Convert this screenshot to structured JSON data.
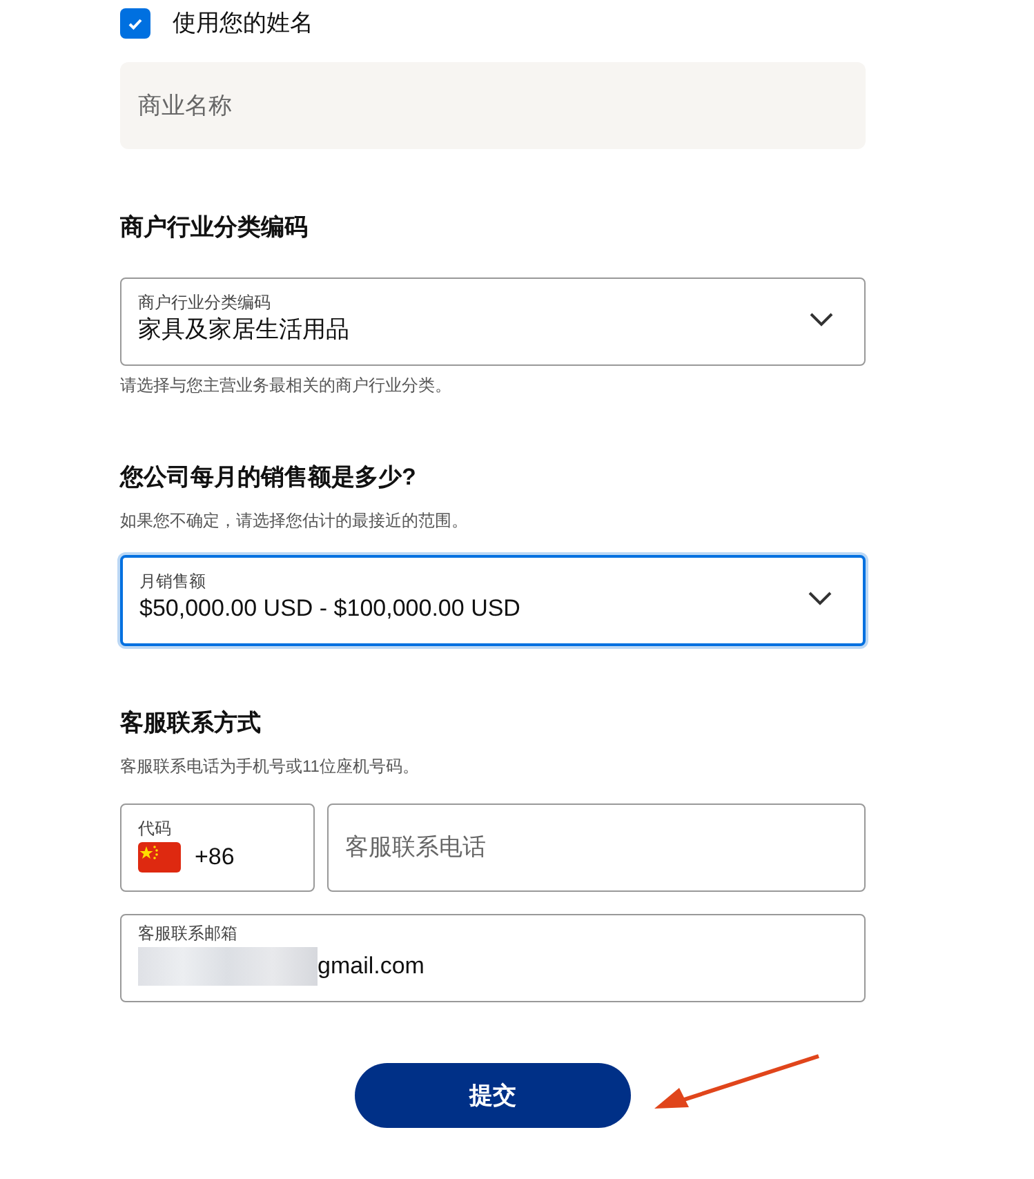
{
  "use_name": {
    "label": "使用您的姓名",
    "checked": true
  },
  "business_name": {
    "placeholder": "商业名称"
  },
  "category_section": {
    "heading": "商户行业分类编码",
    "select": {
      "label": "商户行业分类编码",
      "value": "家具及家居生活用品",
      "focused": false
    },
    "helper": "请选择与您主营业务最相关的商户行业分类。"
  },
  "sales_section": {
    "heading": "您公司每月的销售额是多少?",
    "subtitle": "如果您不确定，请选择您估计的最接近的范围。",
    "select": {
      "label": "月销售额",
      "value": "$50,000.00 USD - $100,000.00 USD",
      "focused": true
    }
  },
  "contact_section": {
    "heading": "客服联系方式",
    "subtitle": "客服联系电话为手机号或11位座机号码。",
    "code": {
      "label": "代码",
      "value": "+86"
    },
    "phone": {
      "placeholder": "客服联系电话"
    },
    "email": {
      "label": "客服联系邮箱",
      "value": "gmail.com"
    }
  },
  "submit": {
    "label": "提交"
  }
}
